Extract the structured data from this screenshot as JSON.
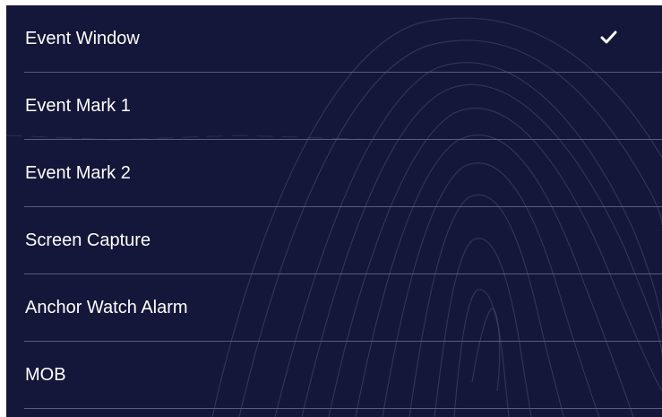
{
  "menu": {
    "items": [
      {
        "label": "Event Window",
        "checked": true
      },
      {
        "label": "Event Mark 1",
        "checked": false
      },
      {
        "label": "Event Mark 2",
        "checked": false
      },
      {
        "label": "Screen Capture",
        "checked": false
      },
      {
        "label": "Anchor Watch Alarm",
        "checked": false
      },
      {
        "label": "MOB",
        "checked": false
      }
    ],
    "check_icon": "checkmark-icon"
  },
  "colors": {
    "background": "#14163a",
    "text": "#ffffff",
    "divider": "#5a5d79"
  }
}
